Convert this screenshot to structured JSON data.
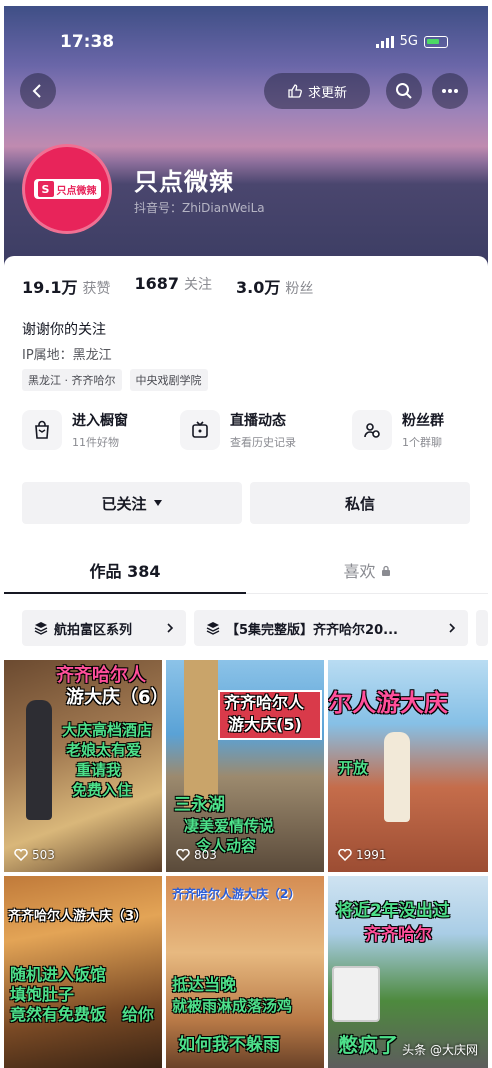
{
  "status_bar": {
    "time": "17:38",
    "network": "5G"
  },
  "header": {
    "want_update_label": "求更新"
  },
  "profile": {
    "nickname": "只点微辣",
    "douyin_id": "抖音号：ZhiDianWeiLa",
    "avatar_text": "只点微辣"
  },
  "stats": [
    {
      "value": "19.1万",
      "label": "获赞"
    },
    {
      "value": "1687",
      "label": "关注"
    },
    {
      "value": "3.0万",
      "label": "粉丝"
    }
  ],
  "bio": "谢谢你的关注",
  "ip_location": "IP属地：黑龙江",
  "tags": [
    "黑龙江 · 齐齐哈尔",
    "中央戏剧学院"
  ],
  "features": [
    {
      "title": "进入橱窗",
      "subtitle": "11件好物"
    },
    {
      "title": "直播动态",
      "subtitle": "查看历史记录"
    },
    {
      "title": "粉丝群",
      "subtitle": "1个群聊"
    }
  ],
  "actions": {
    "followed_label": "已关注",
    "message_label": "私信"
  },
  "tabs": {
    "works_label": "作品 384",
    "likes_label": "喜欢"
  },
  "collections": [
    {
      "label": "航拍富区系列"
    },
    {
      "label": "【5集完整版】齐齐哈尔20..."
    }
  ],
  "videos": [
    {
      "title_line1": "齐齐哈尔人",
      "title_line2": "游大庆（6）",
      "body": [
        "大庆高档酒店",
        "老娘太有爱",
        "重请我",
        "免费入住"
      ],
      "likes": "503"
    },
    {
      "title_line1": "齐齐哈尔人",
      "title_line2": "游大庆(5)",
      "body": [
        "三永湖",
        "凄美爱情传说",
        "令人动容"
      ],
      "likes": "803"
    },
    {
      "title_line1": "尔人游大庆",
      "body": [
        "开放"
      ],
      "likes": "1991"
    },
    {
      "title_line1": "齐齐哈尔人游大庆（3）",
      "body": [
        "随机进入饭馆",
        "填饱肚子",
        "竟然有免费饭",
        "给你"
      ],
      "likes": ""
    },
    {
      "title_line1": "齐齐哈尔人游大庆（2）",
      "body": [
        "抵达当晚",
        "就被雨淋成落汤鸡",
        "如何我不躲雨"
      ],
      "likes": ""
    },
    {
      "title_line1": "将近2年没出过",
      "title_line2": "齐齐哈尔",
      "body": [
        "憋疯了"
      ],
      "likes": ""
    }
  ],
  "watermark": "头条 @大庆网"
}
